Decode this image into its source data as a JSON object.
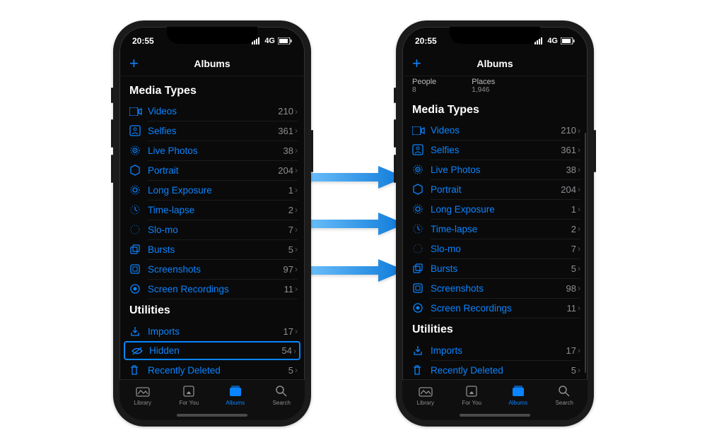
{
  "statusbar": {
    "time": "20:55",
    "network": "4G"
  },
  "navbar": {
    "title": "Albums",
    "add_label": "+"
  },
  "phone1": {
    "section1": "Media Types",
    "media": [
      {
        "name": "Videos",
        "count": "210"
      },
      {
        "name": "Selfies",
        "count": "361"
      },
      {
        "name": "Live Photos",
        "count": "38"
      },
      {
        "name": "Portrait",
        "count": "204"
      },
      {
        "name": "Long Exposure",
        "count": "1"
      },
      {
        "name": "Time-lapse",
        "count": "2"
      },
      {
        "name": "Slo-mo",
        "count": "7"
      },
      {
        "name": "Bursts",
        "count": "5"
      },
      {
        "name": "Screenshots",
        "count": "97"
      },
      {
        "name": "Screen Recordings",
        "count": "11"
      }
    ],
    "section2": "Utilities",
    "utilities": [
      {
        "name": "Imports",
        "count": "17"
      },
      {
        "name": "Hidden",
        "count": "54",
        "highlight": true
      },
      {
        "name": "Recently Deleted",
        "count": "5"
      }
    ]
  },
  "phone2": {
    "mini_people_label": "People",
    "mini_people_count": "8",
    "mini_places_label": "Places",
    "mini_places_count": "1,946",
    "section1": "Media Types",
    "media": [
      {
        "name": "Videos",
        "count": "210"
      },
      {
        "name": "Selfies",
        "count": "361"
      },
      {
        "name": "Live Photos",
        "count": "38"
      },
      {
        "name": "Portrait",
        "count": "204"
      },
      {
        "name": "Long Exposure",
        "count": "1"
      },
      {
        "name": "Time-lapse",
        "count": "2"
      },
      {
        "name": "Slo-mo",
        "count": "7"
      },
      {
        "name": "Bursts",
        "count": "5"
      },
      {
        "name": "Screenshots",
        "count": "98"
      },
      {
        "name": "Screen Recordings",
        "count": "11"
      }
    ],
    "section2": "Utilities",
    "utilities": [
      {
        "name": "Imports",
        "count": "17"
      },
      {
        "name": "Recently Deleted",
        "count": "5"
      }
    ]
  },
  "tabs": [
    {
      "label": "Library"
    },
    {
      "label": "For You"
    },
    {
      "label": "Albums"
    },
    {
      "label": "Search"
    }
  ]
}
